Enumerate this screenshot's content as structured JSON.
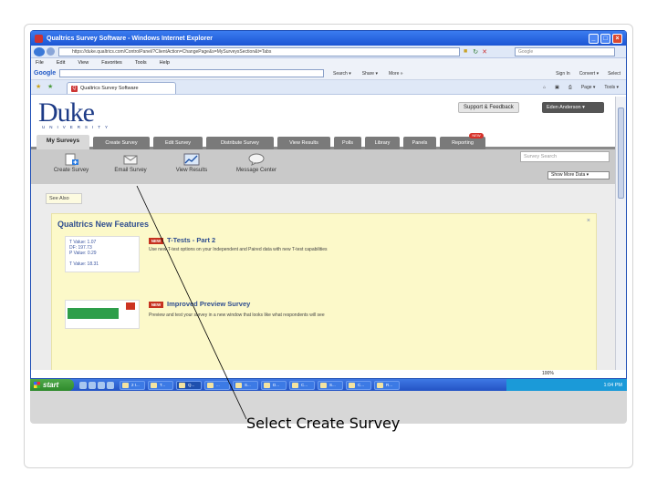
{
  "window": {
    "title": "Qualtrics Survey Software - Windows Internet Explorer",
    "min": "_",
    "max": "□",
    "close": "×"
  },
  "browser": {
    "address": "https://duke.qualtrics.com/ControlPanel/?ClientAction=ChangePage&s=MySurveysSection&t=Tabs",
    "search_placeholder": "Google",
    "menu": [
      "File",
      "Edit",
      "View",
      "Favorites",
      "Tools",
      "Help"
    ],
    "google_label": "Google",
    "google_items": [
      "Search ▾",
      "Share ▾",
      "More »"
    ],
    "google_right": [
      "Sign In",
      "Convert ▾",
      "Select"
    ],
    "page_tab": "Qualtrics Survey Software",
    "tab_tools": [
      "Page ▾",
      "Tools ▾"
    ],
    "zoom": "100%"
  },
  "header": {
    "logo": "Duke",
    "logo_sub": "UNIVERSITY",
    "support": "Support & Feedback",
    "user": "Eden Anderson ▾"
  },
  "nav_tabs": [
    "My Surveys",
    "Create Survey",
    "Edit Survey",
    "Distribute Survey",
    "View Results",
    "Polls",
    "Library",
    "Panels",
    "Reporting"
  ],
  "nav_badge": "NEW",
  "toolbar": {
    "items": [
      "Create Survey",
      "Email Survey",
      "View Results",
      "Message Center"
    ],
    "search_placeholder": "Survey Search",
    "show_more": "Show More Data ▾"
  },
  "sub_tab": "See Also",
  "features": {
    "title": "Qualtrics New Features",
    "close": "×",
    "thumb1_text": "T Value: 1.07\nDF: 197.73\nP Value: 0.29\n\nT Value: 18.31",
    "items": [
      {
        "badge": "NEW",
        "heading": "T-Tests - Part 2",
        "desc": "Use new T-test options on your Independent and Paired data with new T-test capabilities"
      },
      {
        "badge": "NEW",
        "heading": "Improved Preview Survey",
        "desc": "Preview and test your survey in a new window that looks like what respondents will see"
      }
    ]
  },
  "taskbar": {
    "start": "start",
    "items": [
      "2 I...",
      "T...",
      "Q...",
      "...",
      "S...",
      "D...",
      "C...",
      "S...",
      "C...",
      "R..."
    ],
    "time": "1:04 PM"
  },
  "caption": "Select Create Survey",
  "colors": {
    "duke_blue": "#1d3b87",
    "tab_gray": "#7a7a7a",
    "features_bg": "#fcf9c9",
    "new_badge": "#c6321f",
    "xp_blue": "#2453c4"
  }
}
